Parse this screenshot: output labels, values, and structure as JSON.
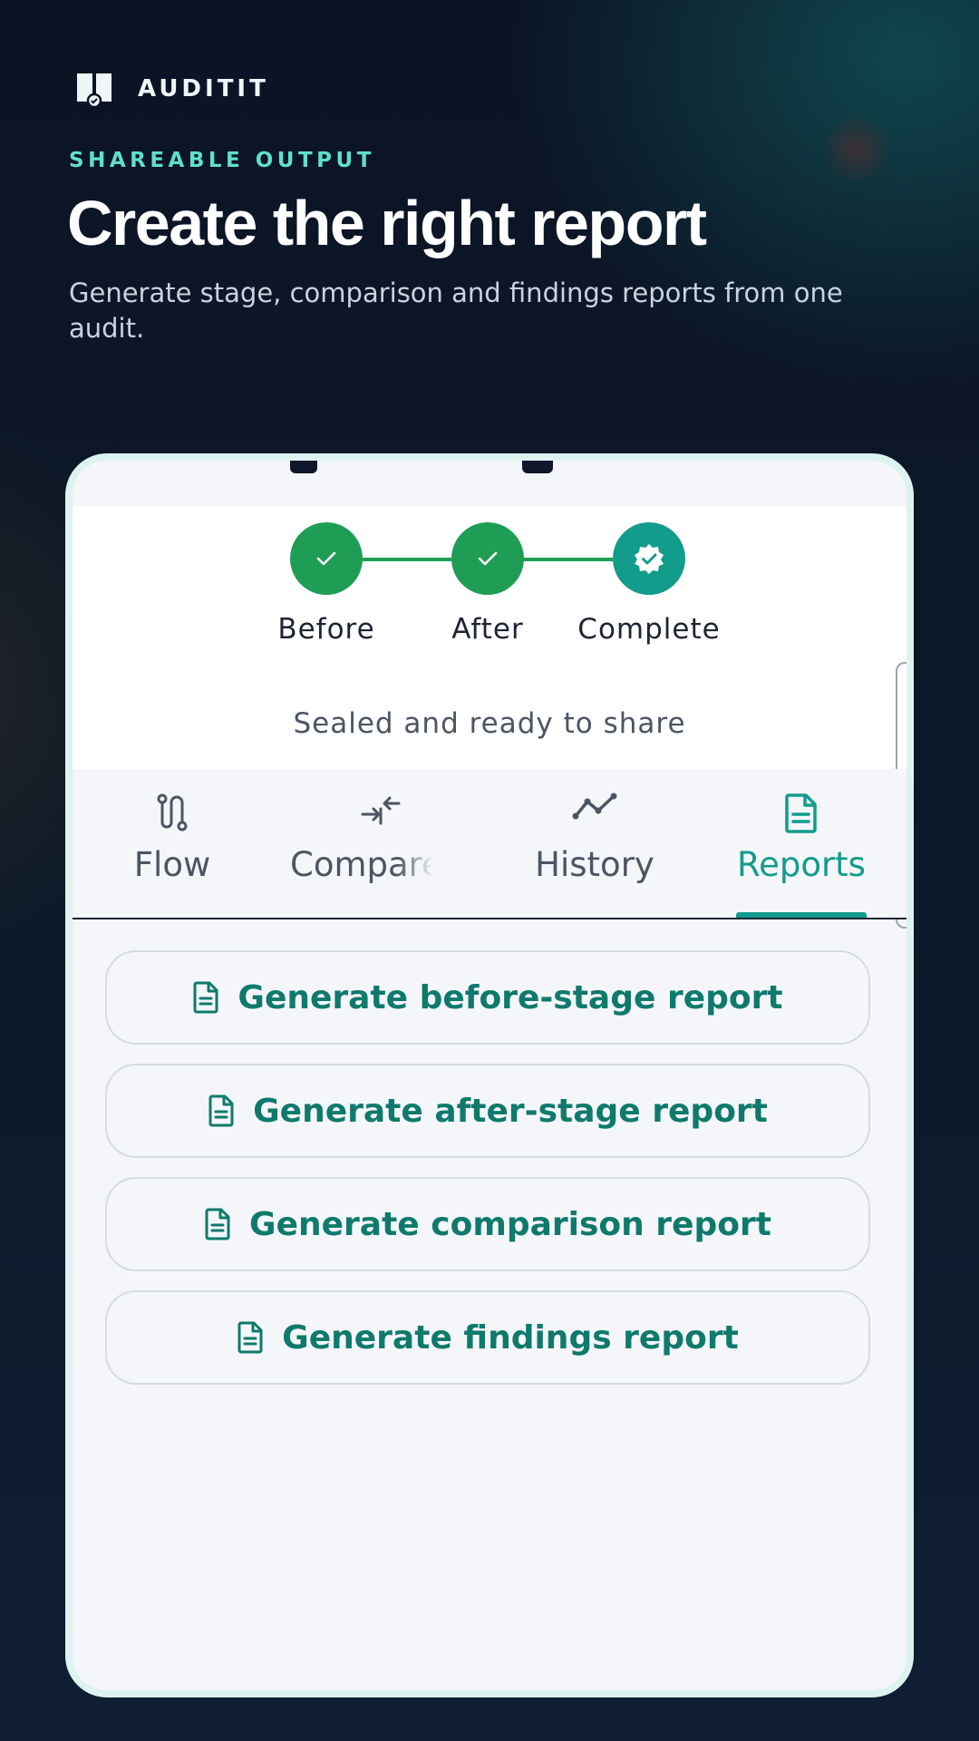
{
  "brand": {
    "name": "AUDITIT",
    "logo_icon": "audit-logo-icon"
  },
  "hero": {
    "eyebrow": "SHAREABLE OUTPUT",
    "title": "Create the right report",
    "subtitle": "Generate stage, comparison and findings reports from one audit."
  },
  "progress": {
    "steps": [
      {
        "label": "Before",
        "state": "done"
      },
      {
        "label": "After",
        "state": "done"
      },
      {
        "label": "Complete",
        "state": "sealed"
      }
    ],
    "status": "Sealed and ready to share"
  },
  "tabs": [
    {
      "label": "Flow",
      "icon": "flow-icon",
      "active": false
    },
    {
      "label": "Compare",
      "icon": "compare-icon",
      "active": false
    },
    {
      "label": "History",
      "icon": "history-icon",
      "active": false
    },
    {
      "label": "Reports",
      "icon": "document-icon",
      "active": true
    }
  ],
  "reports": {
    "before": "Generate before-stage report",
    "after": "Generate after-stage report",
    "comparison": "Generate comparison report",
    "findings": "Generate findings report"
  },
  "colors": {
    "accent": "#0f7a6c",
    "step_done": "#1f9d55",
    "step_sealed": "#129c8c",
    "eyebrow": "#5fe0c8",
    "tab_inactive": "#4b5563",
    "tab_active": "#129c8c"
  }
}
